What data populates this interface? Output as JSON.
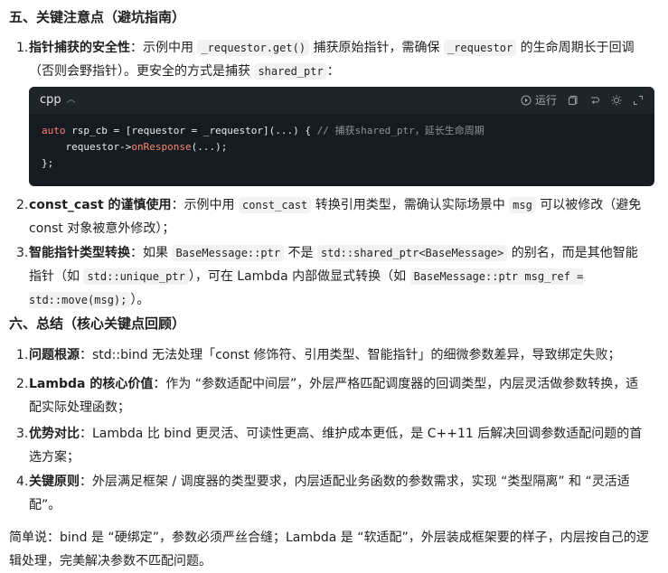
{
  "section5": {
    "heading": "五、关键注意点（避坑指南）",
    "items": [
      {
        "num": "1.",
        "title": "指针捕获的安全性",
        "t1": "：示例中用 ",
        "c1": "_requestor.get()",
        "t2": " 捕获原始指针，需确保 ",
        "c2": "_requestor",
        "t3": " 的生命周期长于回调（否则会野指针）。更安全的方式是捕获 ",
        "c3": "shared_ptr",
        "t4": "："
      },
      {
        "num": "2.",
        "title": "const_cast 的谨慎使用",
        "t1": "：示例中用 ",
        "c1": "const_cast",
        "t2": " 转换引用类型，需确认实际场景中 ",
        "c2": "msg",
        "t3": " 可以被修改（避免 const 对象被意外修改）；"
      },
      {
        "num": "3.",
        "title": "智能指针类型转换",
        "t1": "：如果 ",
        "c1": "BaseMessage::ptr",
        "t2": " 不是 ",
        "c2": "std::shared_ptr<BaseMessage>",
        "t3": " 的别名，而是其他智能指针（如 ",
        "c3": "std::unique_ptr",
        "t4": "），可在 Lambda 内部做显式转换（如 ",
        "c4": "BaseMessage::ptr msg_ref = std::move(msg);",
        "t5": "）。"
      }
    ]
  },
  "codeblock": {
    "lang": "cpp",
    "run_label": "运行",
    "line1_kw": "auto",
    "line1_a": " rsp_cb = [requestor = _requestor](...) { ",
    "line1_cm": "// 捕获shared_ptr，延长生命周期",
    "line2_a": "    requestor->",
    "line2_fn": "onResponse",
    "line2_b": "(...);",
    "line3": "};"
  },
  "section6": {
    "heading": "六、总结（核心关键点回顾）",
    "items": [
      {
        "num": "1.",
        "title": "问题根源",
        "text": "：std::bind 无法处理「const 修饰符、引用类型、智能指针」的细微参数差异，导致绑定失败；"
      },
      {
        "num": "2.",
        "title": "Lambda 的核心价值",
        "text": "：作为 “参数适配中间层”，外层严格匹配调度器的回调类型，内层灵活做参数转换，适配实际处理函数；"
      },
      {
        "num": "3.",
        "title": "优势对比",
        "text": "：Lambda 比 bind 更灵活、可读性更高、维护成本更低，是 C++11 后解决回调参数适配问题的首选方案；"
      },
      {
        "num": "4.",
        "title": "关键原则",
        "text": "：外层满足框架 / 调度器的类型要求，内层适配业务函数的参数需求，实现 “类型隔离” 和 “灵活适配”。"
      }
    ]
  },
  "summary": "简单说：bind 是 “硬绑定”，参数必须严丝合缝；Lambda 是 “软适配”，外层装成框架要的样子，内层按自己的逻辑处理，完美解决参数不匹配问题。"
}
